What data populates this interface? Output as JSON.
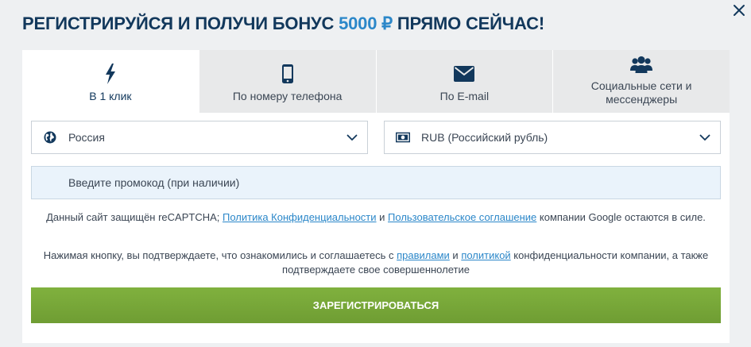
{
  "header": {
    "title_part1": "РЕГИСТРИРУЙСЯ И ПОЛУЧИ БОНУС ",
    "title_bonus": "5000 ₽",
    "title_part2": " ПРЯМО СЕЙЧАС!"
  },
  "tabs": [
    {
      "label": "В 1 клик",
      "icon": "lightning-icon",
      "active": true
    },
    {
      "label": "По номеру телефона",
      "icon": "phone-icon",
      "active": false
    },
    {
      "label": "По E-mail",
      "icon": "envelope-icon",
      "active": false
    },
    {
      "label": "Социальные сети и мессенджеры",
      "icon": "users-icon",
      "active": false
    }
  ],
  "form": {
    "country": {
      "value": "Россия",
      "icon": "globe-icon"
    },
    "currency": {
      "value": "RUB (Российский рубль)",
      "icon": "banknote-icon"
    },
    "promo": {
      "placeholder": "Введите промокод (при наличии)"
    }
  },
  "notices": {
    "recaptcha_prefix": "Данный сайт защищён reCAPTCHA; ",
    "privacy_link": "Политика Конфиденциальности",
    "and1": " и ",
    "user_agreement_link": "Пользовательское соглашение",
    "recaptcha_suffix": " компании Google остаются в силе.",
    "terms_prefix": "Нажимая кнопку, вы подтверждаете, что ознакомились и соглашаетесь с ",
    "rules_link": "правилами",
    "and2": " и ",
    "policy_link": "политикой",
    "terms_suffix": " конфиденциальности компании, а также подтверждаете свое совершеннолетие"
  },
  "submit": {
    "label": "ЗАРЕГИСТРИРОВАТЬСЯ"
  },
  "colors": {
    "title": "#12385c",
    "accent": "#2b87c9",
    "button": "#7bab3a",
    "icon": "#12385c"
  }
}
